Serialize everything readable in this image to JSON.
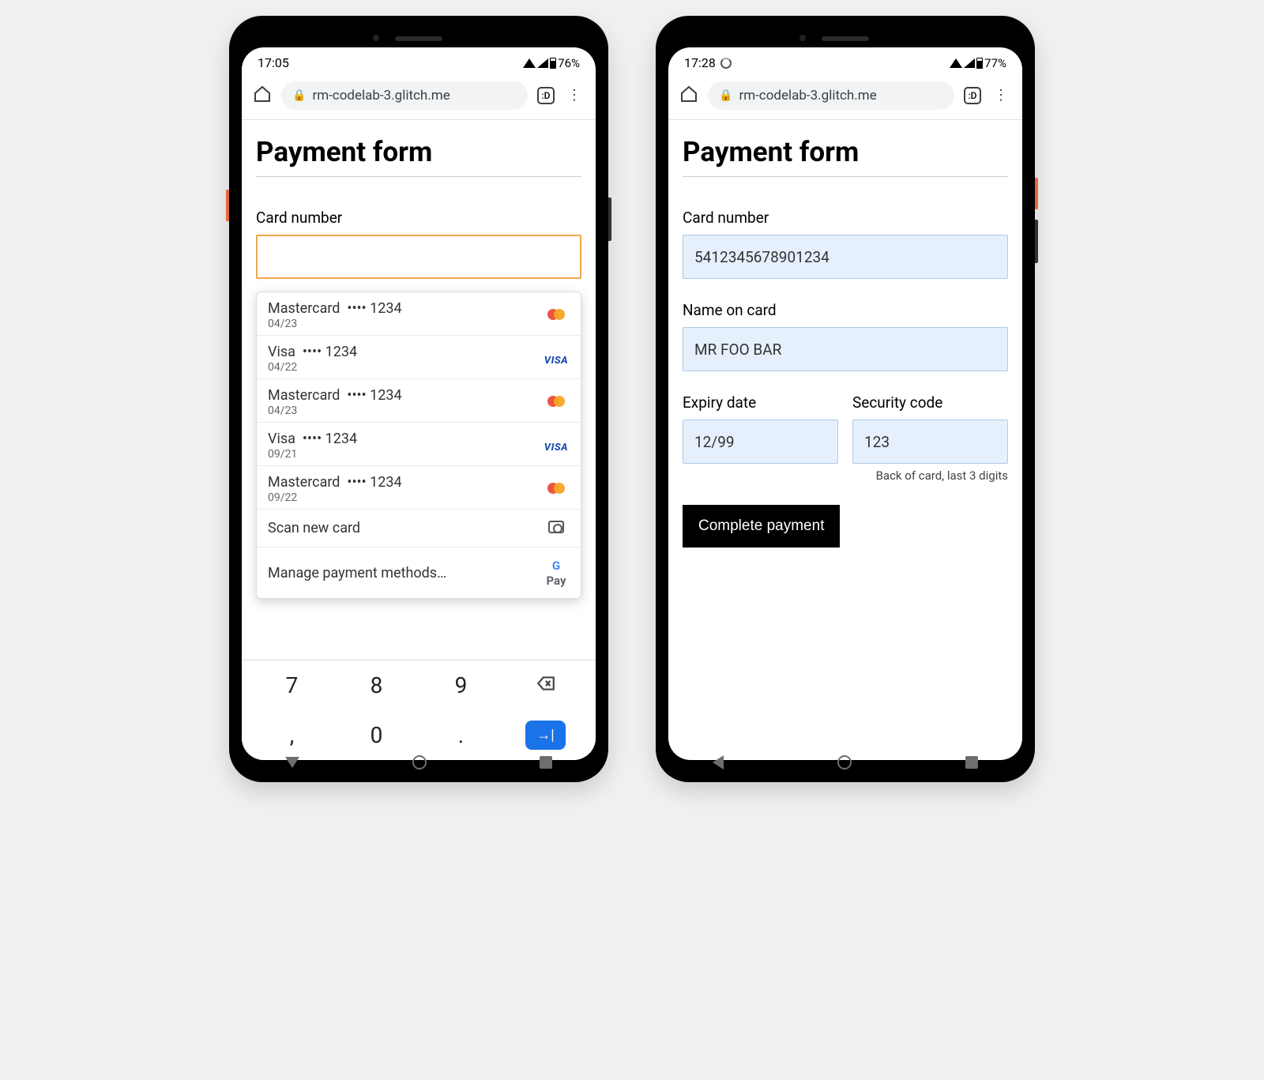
{
  "phone1": {
    "status": {
      "time": "17:05",
      "battery": "76%"
    },
    "url": "rm-codelab-3.glitch.me",
    "title": "Payment form",
    "cardnum_label": "Card number",
    "autofill": {
      "cards": [
        {
          "brand": "Mastercard",
          "mask": "•••• 1234",
          "expiry": "04/23",
          "icon": "mastercard"
        },
        {
          "brand": "Visa",
          "mask": "•••• 1234",
          "expiry": "04/22",
          "icon": "visa"
        },
        {
          "brand": "Mastercard",
          "mask": "•••• 1234",
          "expiry": "04/23",
          "icon": "mastercard"
        },
        {
          "brand": "Visa",
          "mask": "•••• 1234",
          "expiry": "09/21",
          "icon": "visa"
        },
        {
          "brand": "Mastercard",
          "mask": "•••• 1234",
          "expiry": "09/22",
          "icon": "mastercard"
        }
      ],
      "scan": "Scan new card",
      "manage": "Manage payment methods…"
    },
    "keys": {
      "k7": "7",
      "k8": "8",
      "k9": "9",
      "comma": ",",
      "k0": "0",
      "dot": "."
    }
  },
  "phone2": {
    "status": {
      "time": "17:28",
      "battery": "77%"
    },
    "url": "rm-codelab-3.glitch.me",
    "title": "Payment form",
    "cardnum_label": "Card number",
    "cardnum_value": "5412345678901234",
    "name_label": "Name on card",
    "name_value": "MR FOO BAR",
    "expiry_label": "Expiry date",
    "expiry_value": "12/99",
    "cvc_label": "Security code",
    "cvc_value": "123",
    "cvc_help": "Back of card, last 3 digits",
    "submit": "Complete payment"
  }
}
